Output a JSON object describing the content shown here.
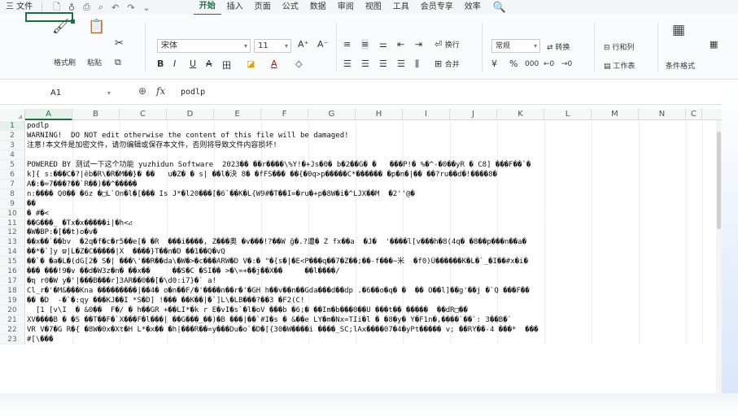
{
  "menubar": {
    "file": "三 文件",
    "quick_icons": [
      "save-icon",
      "paint-icon",
      "print-icon",
      "preview-icon",
      "undo-icon",
      "redo-icon",
      "dropdown-icon"
    ],
    "quick_glyphs": [
      "🗋",
      "♁",
      "⎙",
      "⌕",
      "↶",
      "↷",
      "⌄"
    ],
    "tabs": [
      "开始",
      "插入",
      "页面",
      "公式",
      "数据",
      "审阅",
      "视图",
      "工具",
      "会员专享",
      "效率"
    ],
    "active_tab": "开始",
    "search_glyph": "🔍"
  },
  "ribbon": {
    "format_painter": "格式刷",
    "paste": "粘贴",
    "font_name": "宋体",
    "font_size": "11",
    "increase_font": "A⁺",
    "decrease_font": "A⁻",
    "bold": "B",
    "italic": "I",
    "underline": "U",
    "strike": "A",
    "border": "田",
    "fill": "◪",
    "font_color": "A",
    "clear": "◇",
    "wrap": "换行",
    "merge": "合并",
    "number_format": "常规",
    "convert": "转换",
    "currency": "¥",
    "percent": "%",
    "thousands": "000",
    "dec_inc": "←0",
    "dec_dec": "→0",
    "rows_cols": "行和列",
    "worksheet": "工作表",
    "cond_format": "条件格式"
  },
  "formula_bar": {
    "cell_ref": "A1",
    "zoom_glyph": "⊕",
    "fx": "fx",
    "content": "podlp"
  },
  "columns": [
    "A",
    "B",
    "C",
    "D",
    "E",
    "F",
    "G",
    "H",
    "I",
    "J",
    "K",
    "L",
    "M",
    "N",
    "C"
  ],
  "selected_column": "A",
  "rows": [
    {
      "n": "1",
      "t": "podlp"
    },
    {
      "n": "2",
      "t": "WARNING!  DO NOT edit otherwise the content of this file will be damaged!"
    },
    {
      "n": "3",
      "t": "注意!本文件是加密文件，请勿编辑或保存本文件，否则将导致文件内容损坏!"
    },
    {
      "n": "4",
      "t": ""
    },
    {
      "n": "5",
      "t": "POWERED BY 测试一下这个功能 yuzhidun Software  2023�� ��r����\\%Y!�+Js�0� b�2��G� �   ���P!� %�^-�0��yR � C8] ���F��`�"
    },
    {
      "n": "6",
      "t": "k]{ s:���C�?|ëb�R\\�R�M��}� ��   u�Z� � s| ��l�決 8� �fFS��� ��{�0q>p�����C*������ �p�n�|�� ��?ru��d�!����8�"
    },
    {
      "n": "7",
      "t": "A�:�=7���?��`R��)��^�����"
    },
    {
      "n": "8",
      "t": "n:���� Q0�� �6z �□L`On�l�[��� Is J*�l20���[�6`��K�L{W9#�T��I=�ru�+p�8W�i�^LJX��M  �2''@�"
    },
    {
      "n": "9",
      "t": "��"
    },
    {
      "n": "10",
      "t": "� #�<"
    },
    {
      "n": "11",
      "t": "��G���_ �Tx�x�����i|�h<ሪ"
    },
    {
      "n": "12",
      "t": "�W�BP:�[��t)o�v�"
    },
    {
      "n": "13",
      "t": "��x��`��bv  �2q�f�c�r5��e[� �R  ���i����, Z���奥 �v���!?��W ĝ�.?遭� Z fx��a  �J�  '����l[v���h�8(4q� �8��p���n��a�"
    },
    {
      "n": "14",
      "t": "��*�`]y ϖ|L�Z�C�����|X  ����}T��n�D ��1��Q�vQ"
    },
    {
      "n": "15",
      "t": "��`� �a�L�(dG[2� S�| ���\\'��R��da\\�W�>�c���ARW�D V�:� \"�{s�|�E<P���q��7�Z��;��-f���−米  �f0)Ü������K�L�`_�I��#x�i�"
    },
    {
      "n": "16",
      "t": "��� ���!9�v ��d�W3z�n� ��x��     ��S�C �SI�� >�\\=+��j��X��     ��l����/"
    },
    {
      "n": "17",
      "t": "�ຖ r0�W y�'|���B���r]3AR��0��[�\\d0:i7}�` a!"
    },
    {
      "n": "18",
      "t": "Cl_r�'�M&���Kna ���������|��4� o�n��F/�'����n��r�'�GH h��v��n��Gda���d��dp .�6��o�q� �  �� O��l]��g'��j �`Q ���F��"
    },
    {
      "n": "19",
      "t": "�� �D  -�`�:qy ���KJ��I *S�D] !��� ��K��|�`]L\\�LB���?��3 �F2(C!"
    },
    {
      "n": "20",
      "t": "  [1 [v\\I  � &0��  F�/ � h��GR +��LI*�k r E�vI�s`�l�oV ���b �6;� ��Im�b���0��U ���t�� �����  ��dR□��"
    },
    {
      "n": "21",
      "t": "XV����B � �S ��T��F�`X���F�l���| ��G���_��)�B ���|��`#I�s � &��e LY�m�Nx=TIi�l � �8�y� Y�F1n�,����`��`: 3��B�`"
    },
    {
      "n": "22",
      "t": "VR V�7�G R�{ �8W�0x�Xt�H L*�x�� �h|���R��=y���Du�o`�D�[{30�W����i ����_SC;lAx����07�4�yPt����� v; ��RY��-4 ���*  ���"
    },
    {
      "n": "23",
      "t": "#[\\���"
    }
  ]
}
